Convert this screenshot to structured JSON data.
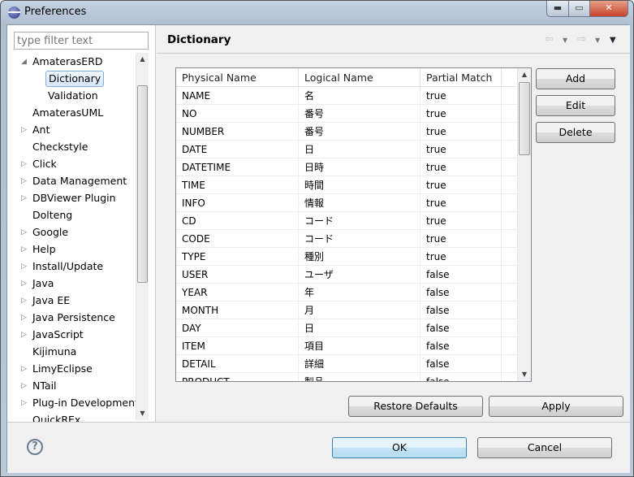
{
  "window": {
    "title": "Preferences",
    "icon": "eclipse-icon",
    "controls": [
      "minimize",
      "maximize",
      "close"
    ]
  },
  "sidebar": {
    "filter_placeholder": "type filter text",
    "items": [
      {
        "label": "AmaterasERD",
        "level": 0,
        "expander": "expanded"
      },
      {
        "label": "Dictionary",
        "level": 1,
        "expander": "none",
        "selected": true
      },
      {
        "label": "Validation",
        "level": 1,
        "expander": "none"
      },
      {
        "label": "AmaterasUML",
        "level": 0,
        "expander": "none"
      },
      {
        "label": "Ant",
        "level": 0,
        "expander": "collapsed"
      },
      {
        "label": "Checkstyle",
        "level": 0,
        "expander": "none"
      },
      {
        "label": "Click",
        "level": 0,
        "expander": "collapsed"
      },
      {
        "label": "Data Management",
        "level": 0,
        "expander": "collapsed"
      },
      {
        "label": "DBViewer Plugin",
        "level": 0,
        "expander": "collapsed"
      },
      {
        "label": "Dolteng",
        "level": 0,
        "expander": "none"
      },
      {
        "label": "Google",
        "level": 0,
        "expander": "collapsed"
      },
      {
        "label": "Help",
        "level": 0,
        "expander": "collapsed"
      },
      {
        "label": "Install/Update",
        "level": 0,
        "expander": "collapsed"
      },
      {
        "label": "Java",
        "level": 0,
        "expander": "collapsed"
      },
      {
        "label": "Java EE",
        "level": 0,
        "expander": "collapsed"
      },
      {
        "label": "Java Persistence",
        "level": 0,
        "expander": "collapsed"
      },
      {
        "label": "JavaScript",
        "level": 0,
        "expander": "collapsed"
      },
      {
        "label": "Kijimuna",
        "level": 0,
        "expander": "none"
      },
      {
        "label": "LimyEclipse",
        "level": 0,
        "expander": "collapsed"
      },
      {
        "label": "NTail",
        "level": 0,
        "expander": "collapsed"
      },
      {
        "label": "Plug-in Development",
        "level": 0,
        "expander": "collapsed"
      },
      {
        "label": "QuickREx",
        "level": 0,
        "expander": "none"
      }
    ]
  },
  "page": {
    "title": "Dictionary",
    "table": {
      "columns": [
        "Physical Name",
        "Logical Name",
        "Partial Match"
      ],
      "rows": [
        [
          "NAME",
          "名",
          "true"
        ],
        [
          "NO",
          "番号",
          "true"
        ],
        [
          "NUMBER",
          "番号",
          "true"
        ],
        [
          "DATE",
          "日",
          "true"
        ],
        [
          "DATETIME",
          "日時",
          "true"
        ],
        [
          "TIME",
          "時間",
          "true"
        ],
        [
          "INFO",
          "情報",
          "true"
        ],
        [
          "CD",
          "コード",
          "true"
        ],
        [
          "CODE",
          "コード",
          "true"
        ],
        [
          "TYPE",
          "種別",
          "true"
        ],
        [
          "USER",
          "ユーザ",
          "false"
        ],
        [
          "YEAR",
          "年",
          "false"
        ],
        [
          "MONTH",
          "月",
          "false"
        ],
        [
          "DAY",
          "日",
          "false"
        ],
        [
          "ITEM",
          "項目",
          "false"
        ],
        [
          "DETAIL",
          "詳細",
          "false"
        ],
        [
          "PRODUCT",
          "製品",
          "false"
        ]
      ]
    },
    "buttons": {
      "add": "Add",
      "edit": "Edit",
      "delete": "Delete",
      "restore": "Restore Defaults",
      "apply": "Apply"
    }
  },
  "footer": {
    "ok": "OK",
    "cancel": "Cancel",
    "help_icon": "help-icon"
  }
}
